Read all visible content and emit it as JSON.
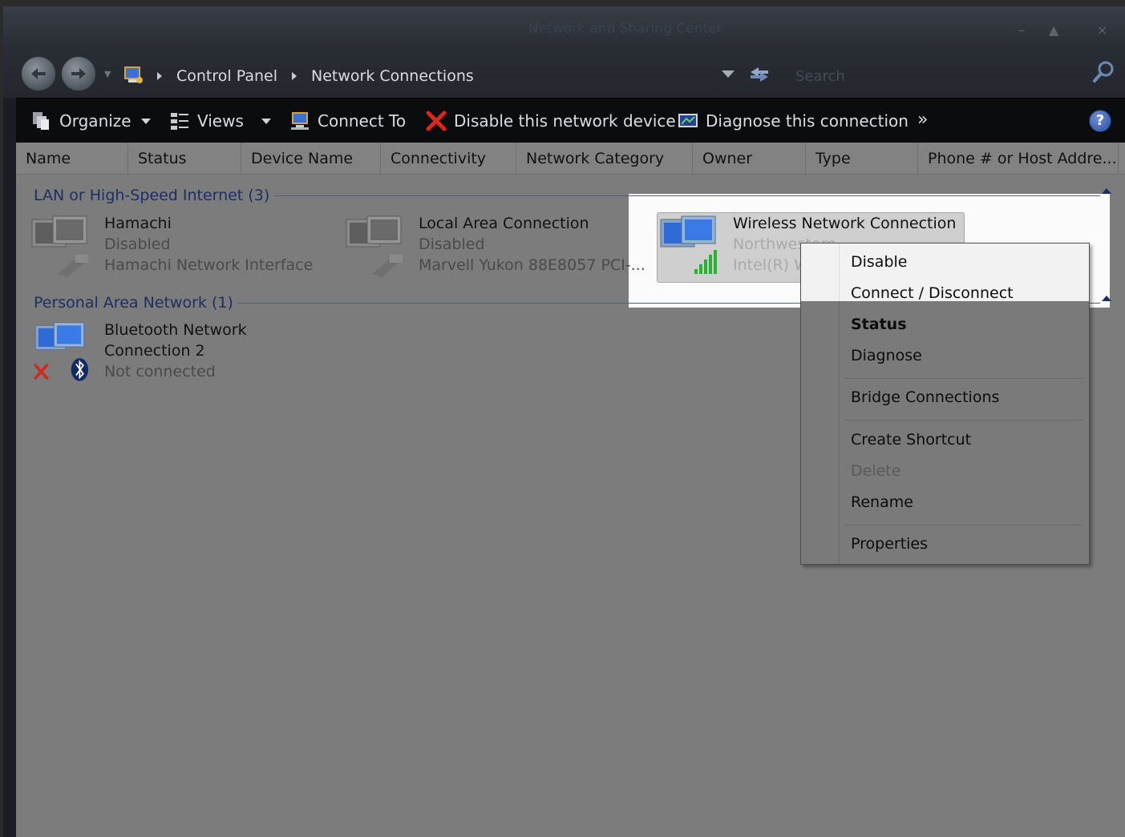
{
  "window": {
    "title": "Network and Sharing Center",
    "controls": [
      "–",
      "▲",
      "×"
    ]
  },
  "address": {
    "crumbs": [
      "Control Panel",
      "Network Connections"
    ],
    "search_placeholder": "Search"
  },
  "toolbar": {
    "organize": "Organize",
    "views": "Views",
    "connect_to": "Connect To",
    "disable_device": "Disable this network device",
    "diagnose": "Diagnose this connection",
    "more": "»",
    "help": "?"
  },
  "columns": [
    "Name",
    "Status",
    "Device Name",
    "Connectivity",
    "Network Category",
    "Owner",
    "Type",
    "Phone # or Host Addre..."
  ],
  "groups": [
    {
      "label": "LAN or High-Speed Internet (3)",
      "items": [
        {
          "name": "Hamachi",
          "status": "Disabled",
          "device": "Hamachi Network Interface"
        },
        {
          "name": "Local Area Connection",
          "status": "Disabled",
          "device": "Marvell Yukon 88E8057 PCI-..."
        },
        {
          "name": "Wireless Network Connection",
          "status": "Northwestern",
          "device": "Intel(R) W"
        }
      ]
    },
    {
      "label": "Personal Area Network (1)",
      "items": [
        {
          "name": "Bluetooth Network",
          "name2": "Connection 2",
          "status": "Not connected"
        }
      ]
    }
  ],
  "context_menu": [
    "Disable",
    "Connect / Disconnect",
    "Status",
    "Diagnose",
    "Bridge Connections",
    "Create Shortcut",
    "Delete",
    "Rename",
    "Properties"
  ],
  "colors": {
    "group_label": "#1d2f60",
    "selection": "#cfcfcf",
    "signal": "#27b22f"
  }
}
